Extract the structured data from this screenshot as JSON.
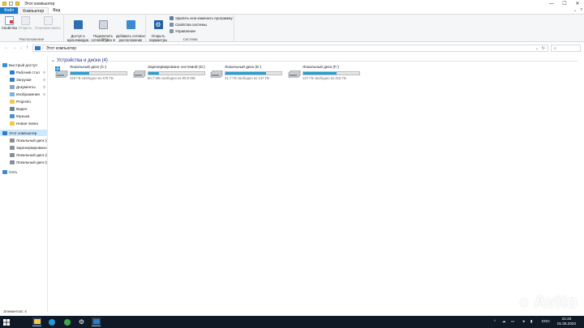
{
  "window": {
    "title": "Этот компьютер",
    "controls": {
      "minimize": "—",
      "maximize": "☐",
      "close": "✕"
    }
  },
  "ribbon": {
    "tabs": [
      "Файл",
      "Компьютер",
      "Вид"
    ],
    "help": "?",
    "groups": {
      "location": {
        "label": "Расположение",
        "buttons": [
          "Свойства",
          "Открыть",
          "Переименовать"
        ]
      },
      "network": {
        "label": "Сеть",
        "buttons": [
          "Доступ к\nмультимедиа ▾",
          "Подключить\nсетевой диск ▾",
          "Добавить сетевое\nрасположение"
        ]
      },
      "system": {
        "label": "Система",
        "open_params": "Открыть\nпараметры",
        "items": [
          "Удалить или изменить программу",
          "Свойства системы",
          "Управление"
        ]
      }
    }
  },
  "address": {
    "back": "←",
    "forward": "→",
    "up": "↑",
    "crumb_sep": "›",
    "path": "Этот компьютер",
    "refresh": "↻",
    "dropdown": "⌄"
  },
  "nav": {
    "items": [
      {
        "label": "Быстрый доступ",
        "icon": "star-icon",
        "pinned": false
      },
      {
        "label": "Рабочий стол",
        "icon": "desktop-icon",
        "pinned": true
      },
      {
        "label": "Загрузки",
        "icon": "download-icon",
        "pinned": true
      },
      {
        "label": "Документы",
        "icon": "documents-icon",
        "pinned": true
      },
      {
        "label": "Изображения",
        "icon": "pictures-icon",
        "pinned": true
      },
      {
        "label": "Projectio",
        "icon": "folder-icon",
        "pinned": false
      },
      {
        "label": "Видео",
        "icon": "video-icon",
        "pinned": false
      },
      {
        "label": "Музыка",
        "icon": "music-icon",
        "pinned": false
      },
      {
        "label": "Новая папка",
        "icon": "folder-icon",
        "pinned": false
      },
      {
        "label": "Этот компьютер",
        "icon": "computer-icon",
        "pinned": false,
        "selected": true
      },
      {
        "label": "Локальный диск (C:)",
        "icon": "drive-icon",
        "pinned": false
      },
      {
        "label": "Зарезервировано сист",
        "icon": "drive-icon",
        "pinned": false
      },
      {
        "label": "Локальный диск (E:)",
        "icon": "drive-icon",
        "pinned": false
      },
      {
        "label": "Локальный диск (F:)",
        "icon": "drive-icon",
        "pinned": false
      },
      {
        "label": "Сеть",
        "icon": "network-icon",
        "pinned": false
      }
    ]
  },
  "content": {
    "section_title": "Устройства и диски (4)",
    "drives": [
      {
        "name": "Локальный диск (C:)",
        "free": "319 ГБ свободно из 476 ГБ",
        "used_fraction": 0.33,
        "windows": true
      },
      {
        "name": "Зарезервировано системой (D:)",
        "free": "80,7 МБ свободно из 99,9 МБ",
        "used_fraction": 0.19,
        "windows": false
      },
      {
        "name": "Локальный диск (E:)",
        "free": "41,7 ГБ свободно из 147 ГБ",
        "used_fraction": 0.72,
        "windows": false
      },
      {
        "name": "Локальный диск (F:)",
        "free": "127 ГБ свободно из 318 ГБ",
        "used_fraction": 0.6,
        "windows": false
      }
    ]
  },
  "status": {
    "items_count": "Элементов: 4"
  },
  "taskbar": {
    "tray": {
      "chevron": "^",
      "lang": "ENG",
      "time": "21:43",
      "date": "01.06.2023"
    }
  },
  "watermark": "Avito",
  "colors": {
    "accent": "#1979ca",
    "bar_fill": "#26a0da",
    "taskbar": "#101a27",
    "selection": "#cce8ff"
  }
}
